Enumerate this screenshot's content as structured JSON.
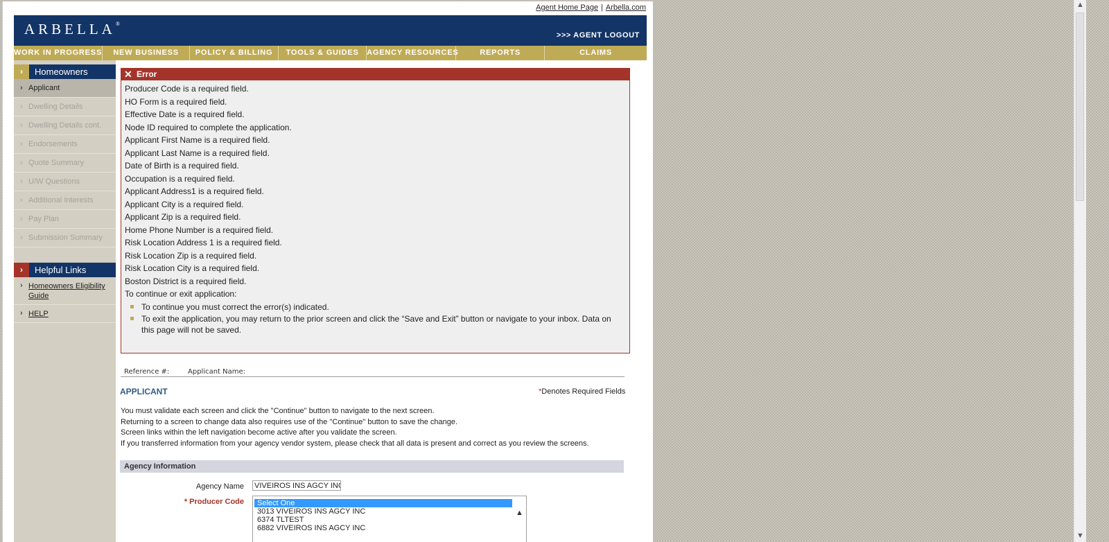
{
  "top_links": {
    "agent_home": "Agent Home Page",
    "arbella_com": "Arbella.com",
    "separator": "|"
  },
  "header": {
    "logo": "ARBELLA",
    "logo_mark": "®",
    "logout": ">>> AGENT LOGOUT"
  },
  "nav": [
    "WORK IN PROGRESS",
    "NEW BUSINESS",
    "POLICY & BILLING",
    "TOOLS & GUIDES",
    "AGENCY RESOURCES",
    "REPORTS",
    "CLAIMS"
  ],
  "sidebar": {
    "section_title": "Homeowners",
    "items": [
      {
        "label": "Applicant",
        "active": true
      },
      {
        "label": "Dwelling Details",
        "active": false
      },
      {
        "label": "Dwelling Details cont.",
        "active": false
      },
      {
        "label": "Endorsements",
        "active": false
      },
      {
        "label": "Quote Summary",
        "active": false
      },
      {
        "label": "U/W Questions",
        "active": false
      },
      {
        "label": "Additional Interests",
        "active": false
      },
      {
        "label": "Pay Plan",
        "active": false
      },
      {
        "label": "Submission Summary",
        "active": false
      }
    ],
    "helpful_title": "Helpful Links",
    "helpful_links": [
      "Homeowners Eligibility Guide",
      "HELP"
    ]
  },
  "error": {
    "title": "Error",
    "messages": [
      "Producer Code is a required field.",
      "HO Form is a required field.",
      "Effective Date is a required field.",
      "Node ID required to complete the application.",
      "Applicant First Name is a required field.",
      "Applicant Last Name is a required field.",
      "Date of Birth is a required field.",
      "Occupation is a required field.",
      "Applicant Address1 is a required field.",
      "Applicant City is a required field.",
      "Applicant Zip is a required field.",
      "Home Phone Number is a required field.",
      "Risk Location Address 1 is a required field.",
      "Risk Location Zip is a required field.",
      "Risk Location City is a required field.",
      "Boston District is a required field."
    ],
    "exit_heading": "To continue or exit application:",
    "bullets": [
      "To continue you must correct the error(s) indicated.",
      "To exit the application, you may return to the prior screen and click the “Save and Exit” button or navigate to your inbox. Data on this page will not be saved."
    ]
  },
  "reference": {
    "ref_label": "Reference #:",
    "applicant_label": "Applicant Name:"
  },
  "section": {
    "title": "APPLICANT",
    "required_star": "*",
    "required_note": "Denotes Required Fields",
    "instructions": [
      "You must validate each screen and click the \"Continue\" button to navigate to the next screen.",
      "Returning to a screen to change data also requires use of the \"Continue\" button to save the change.",
      "Screen links within the left navigation become active after you validate the screen.",
      "If you transferred information from your agency vendor system, please check that all data is present and correct as you review the screens."
    ]
  },
  "agency": {
    "header": "Agency Information",
    "name_label": "Agency Name",
    "name_value": "VIVEIROS INS AGCY INC",
    "producer_label": "* Producer Code",
    "producer_options": [
      "Select One",
      "3013 VIVEIROS INS AGCY INC",
      "6374 TLTEST",
      "6882 VIVEIROS INS AGCY INC"
    ],
    "producer_selected": "Select One"
  },
  "colors": {
    "navy": "#133466",
    "gold": "#bfab55",
    "error_red": "#a4342a",
    "selection_blue": "#3399ff"
  }
}
